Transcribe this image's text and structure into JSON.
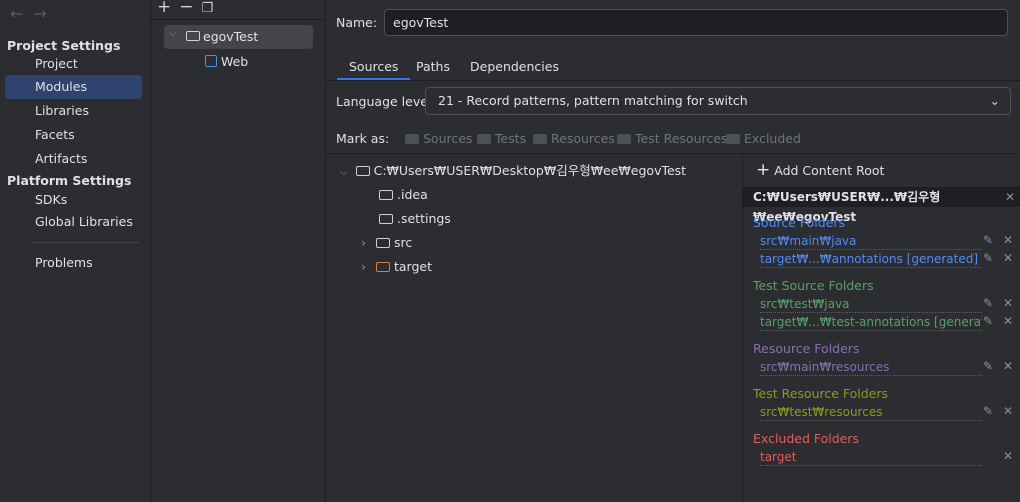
{
  "sidebar": {
    "sections": [
      {
        "title": "Project Settings",
        "items": [
          "Project",
          "Modules",
          "Libraries",
          "Facets",
          "Artifacts"
        ]
      },
      {
        "title": "Platform Settings",
        "items": [
          "SDKs",
          "Global Libraries"
        ]
      }
    ],
    "problems": "Problems",
    "selected": "Modules"
  },
  "modules": {
    "items": [
      {
        "label": "egovTest"
      },
      {
        "label": "Web"
      }
    ]
  },
  "main": {
    "name_label": "Name:",
    "name_value": "egovTest",
    "tabs": [
      "Sources",
      "Paths",
      "Dependencies"
    ],
    "language_label": "Language level:",
    "language_value": "21 - Record patterns, pattern matching for switch",
    "mark_label": "Mark as:",
    "mark_items": [
      "Sources",
      "Tests",
      "Resources",
      "Test Resources",
      "Excluded"
    ],
    "tree": {
      "root": "C:₩Users₩USER₩Desktop₩김우형₩ee₩egovTest",
      "children": [
        ".idea",
        ".settings",
        "src",
        "target"
      ]
    },
    "content_root": {
      "add_label": "Add Content Root",
      "path": "C:₩Users₩USER₩...₩김우형₩ee₩egovTest",
      "groups": [
        {
          "title": "Source Folders",
          "color": "#548af7",
          "folders": [
            "src₩main₩java",
            "target₩...₩annotations [generated]"
          ]
        },
        {
          "title": "Test Source Folders",
          "color": "#5a9f6a",
          "folders": [
            "src₩test₩java",
            "target₩...₩test-annotations [generated]"
          ]
        },
        {
          "title": "Resource Folders",
          "color": "#8a6fb0",
          "folders": [
            "src₩main₩resources"
          ]
        },
        {
          "title": "Test Resource Folders",
          "color": "#8c9a1f",
          "folders": [
            "src₩test₩resources"
          ]
        },
        {
          "title": "Excluded Folders",
          "color": "#e55c5c",
          "folders": [
            "target"
          ]
        }
      ]
    }
  }
}
